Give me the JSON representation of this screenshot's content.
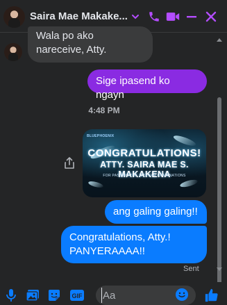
{
  "header": {
    "contact_name": "Saira Mae Makake...",
    "icons": [
      "chevron-down-icon",
      "phone-icon",
      "video-icon",
      "minimize-icon",
      "close-icon"
    ]
  },
  "colors": {
    "accent": "#b44dff",
    "outgoing_blue": "#0a7cff",
    "outgoing_purple": "#8a2be2",
    "incoming": "#3a3b3c",
    "background": "#242526"
  },
  "messages": [
    {
      "id": "m1",
      "direction": "incoming",
      "text": "Wala po ako nareceive, Atty."
    },
    {
      "id": "m2",
      "direction": "outgoing",
      "text": "Sige ipasend ko ngayn"
    },
    {
      "id": "m3",
      "direction": "outgoing",
      "type": "image",
      "image": {
        "brand": "BLUEPHOENIX",
        "title": "CONGRATULATIONS!",
        "name": "ATTY. SAIRA MAE S. MAKAKENA",
        "subtitle": "FOR PASSING THE 2023 BAR EXAMINATIONS"
      }
    },
    {
      "id": "m4",
      "direction": "outgoing",
      "text": "ang galing galing!!"
    },
    {
      "id": "m5",
      "direction": "outgoing",
      "text_line1": "Congratulations, Atty.!",
      "text_line2": "PANYERAAAA!!"
    }
  ],
  "timestamp": "4:48 PM",
  "status": "Sent",
  "composer": {
    "placeholder": "Aa",
    "icons": [
      "microphone-icon",
      "image-icon",
      "sticker-icon",
      "gif-icon",
      "emoji-icon",
      "thumbs-up-icon"
    ],
    "gif_label": "GIF"
  }
}
